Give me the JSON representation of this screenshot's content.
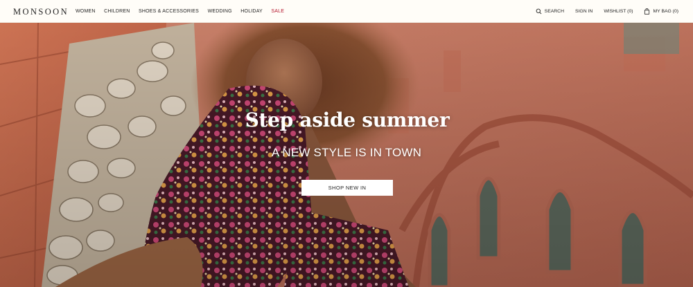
{
  "header": {
    "logo": "MONSOON",
    "nav": [
      {
        "label": "WOMEN"
      },
      {
        "label": "CHILDREN"
      },
      {
        "label": "SHOES & ACCESSORIES"
      },
      {
        "label": "WEDDING"
      },
      {
        "label": "HOLIDAY"
      },
      {
        "label": "SALE"
      }
    ],
    "right": {
      "search": "SEARCH",
      "signin": "SIGN IN",
      "wishlist": "WISHLIST (0)",
      "bag": "MY BAG (0)"
    }
  },
  "hero": {
    "title": "Step aside summer",
    "subtitle": "A NEW STYLE IS IN TOWN",
    "button": "SHOP NEW IN"
  },
  "colors": {
    "sale": "#b3122a",
    "header_bg": "#fffdf8",
    "brick": "#c86a4d"
  },
  "icons": [
    "search-icon",
    "bag-icon"
  ]
}
